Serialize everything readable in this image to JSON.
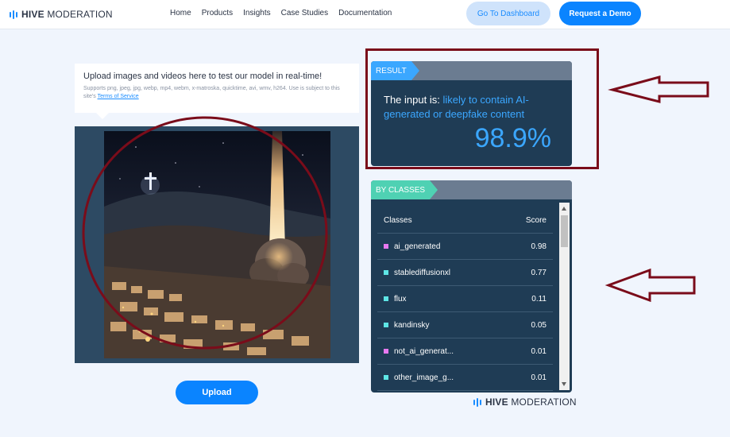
{
  "brand": {
    "bold": "HIVE",
    "rest": "MODERATION"
  },
  "nav": [
    "Home",
    "Products",
    "Insights",
    "Case Studies",
    "Documentation"
  ],
  "header_buttons": {
    "dashboard": "Go To Dashboard",
    "demo": "Request a Demo"
  },
  "upload": {
    "title": "Upload images and videos here to test our model in real-time!",
    "supports": "Supports png, jpeg, jpg, webp, mp4, webm, x-matroska, quicktime, avi, wmv, h264. Use is subject to this site's",
    "terms_link": "Terms of Service",
    "button": "Upload"
  },
  "result": {
    "tag": "RESULT",
    "prefix": "The input is:",
    "verdict": "likely to contain AI-generated or deepfake content",
    "percent": "98.9%"
  },
  "classes": {
    "tag": "BY CLASSES",
    "col_class": "Classes",
    "col_score": "Score",
    "rows": [
      {
        "name": "ai_generated",
        "score": "0.98",
        "color": "#e879f0"
      },
      {
        "name": "stablediffusionxl",
        "score": "0.77",
        "color": "#5ee6e6"
      },
      {
        "name": "flux",
        "score": "0.11",
        "color": "#5ee6e6"
      },
      {
        "name": "kandinsky",
        "score": "0.05",
        "color": "#5ee6e6"
      },
      {
        "name": "not_ai_generat...",
        "score": "0.01",
        "color": "#e879f0"
      },
      {
        "name": "other_image_g...",
        "score": "0.01",
        "color": "#5ee6e6"
      }
    ]
  },
  "colors": {
    "accent": "#0a84ff",
    "panel": "#1f3c55",
    "annotation": "#7a0c1a"
  }
}
